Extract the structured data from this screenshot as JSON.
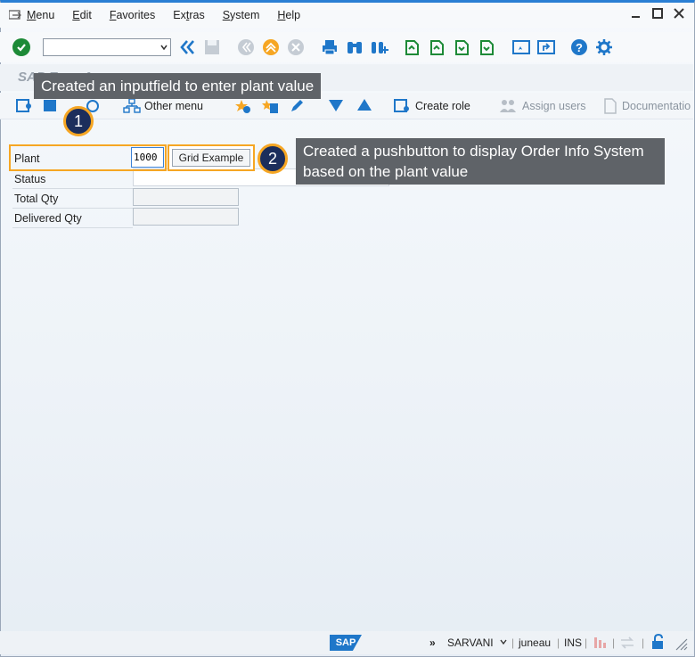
{
  "menubar": {
    "items": [
      "Menu",
      "Edit",
      "Favorites",
      "Extras",
      "System",
      "Help"
    ],
    "underline": [
      "M",
      "E",
      "F",
      "t",
      "S",
      "H"
    ]
  },
  "title": {
    "text": "SAP Easy Access"
  },
  "appbar": {
    "other_menu": "Other menu",
    "create_role": "Create role",
    "assign_users": "Assign users",
    "documentation": "Documentatio"
  },
  "callouts": {
    "one": {
      "badge": "1",
      "text": "Created an inputfield to enter plant value"
    },
    "two": {
      "badge": "2",
      "text_line1": "Created a pushbutton to display Order Info System",
      "text_line2": "based on the plant value"
    }
  },
  "form": {
    "plant_label": "Plant",
    "plant_value": "1000",
    "grid_button": "Grid Example",
    "status_label": "Status",
    "total_qty_label": "Total Qty",
    "delivered_qty_label": "Delivered Qty"
  },
  "statusbar": {
    "logo": "SAP",
    "chevrons": "»",
    "user": "SARVANI",
    "server": "juneau",
    "mode": "INS"
  },
  "colors": {
    "accent": "#f6a623",
    "callout_bg": "#5f6368",
    "badge_bg": "#1c2e5c",
    "sap_blue": "#1f77c9"
  }
}
